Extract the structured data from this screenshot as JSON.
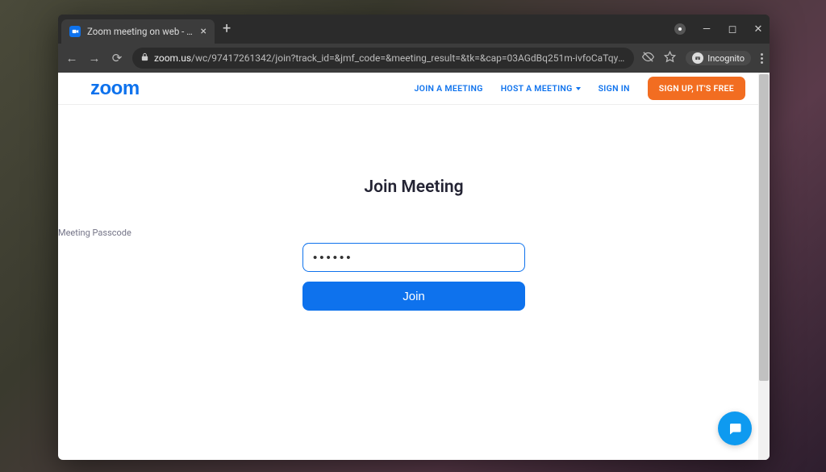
{
  "browser": {
    "tab_title": "Zoom meeting on web - Zoom",
    "url_host": "zoom.us",
    "url_path": "/wc/97417261342/join?track_id=&jmf_code=&meeting_result=&tk=&cap=03AGdBq251m-ivfoCaTqyKaEDjmO6hDgDo6hbgJtOwCorn1FOav...",
    "incognito_label": "Incognito"
  },
  "header": {
    "logo_text": "zoom",
    "join_meeting": "JOIN A MEETING",
    "host_meeting": "HOST A MEETING",
    "sign_in": "SIGN IN",
    "sign_up": "SIGN UP, IT'S FREE"
  },
  "main": {
    "title": "Join Meeting",
    "passcode_label": "Meeting Passcode",
    "passcode_value": "••••••",
    "join_button": "Join"
  }
}
